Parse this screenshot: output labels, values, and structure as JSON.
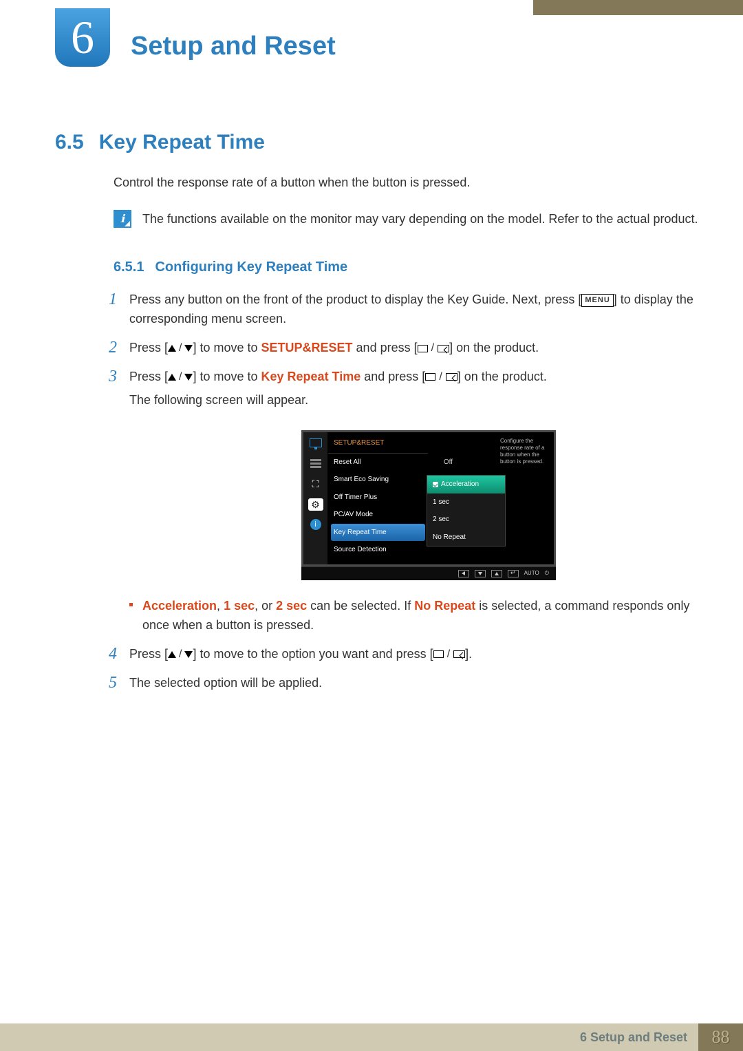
{
  "chapter": {
    "number": "6",
    "title": "Setup and Reset"
  },
  "section": {
    "number": "6.5",
    "title": "Key Repeat Time"
  },
  "intro": "Control the response rate of a button when the button is pressed.",
  "note": "The functions available on the monitor may vary depending on the model. Refer to the actual product.",
  "subsection": {
    "number": "6.5.1",
    "title": "Configuring Key Repeat Time"
  },
  "steps": {
    "s1a": "Press any button on the front of the product to display the Key Guide. Next, press [",
    "s1b": "] to display the corresponding menu screen.",
    "menu_label": "MENU",
    "s2a": "Press [",
    "s2b": "] to move to ",
    "s2c": "SETUP&RESET",
    "s2d": " and press [",
    "s2e": "] on the product.",
    "s3a": "Press [",
    "s3b": "] to move to ",
    "s3c": "Key Repeat Time",
    "s3d": " and press [",
    "s3e": "] on the product.",
    "s3f": "The following screen will appear.",
    "bullet_a": "Acceleration",
    "bullet_b": ", ",
    "bullet_c": "1 sec",
    "bullet_d": ", or ",
    "bullet_e": "2 sec",
    "bullet_f": " can be selected. If ",
    "bullet_g": "No Repeat",
    "bullet_h": " is selected, a command responds only once when a button is pressed.",
    "s4a": "Press [",
    "s4b": "] to move to the option you want and press [",
    "s4c": "].",
    "s5": "The selected option will be applied."
  },
  "osd": {
    "title": "SETUP&RESET",
    "items": {
      "reset": "Reset All",
      "eco": "Smart Eco Saving",
      "eco_val": "Off",
      "timer": "Off Timer Plus",
      "pcav": "PC/AV Mode",
      "key": "Key Repeat Time",
      "source": "Source Detection"
    },
    "submenu": {
      "accel": "Acceleration",
      "one": "1 sec",
      "two": "2 sec",
      "none": "No Repeat"
    },
    "desc": "Configure the response rate of a button when the button is pressed.",
    "footer_auto": "AUTO"
  },
  "footer": {
    "chapter_ref": "6 Setup and Reset",
    "page": "88"
  }
}
